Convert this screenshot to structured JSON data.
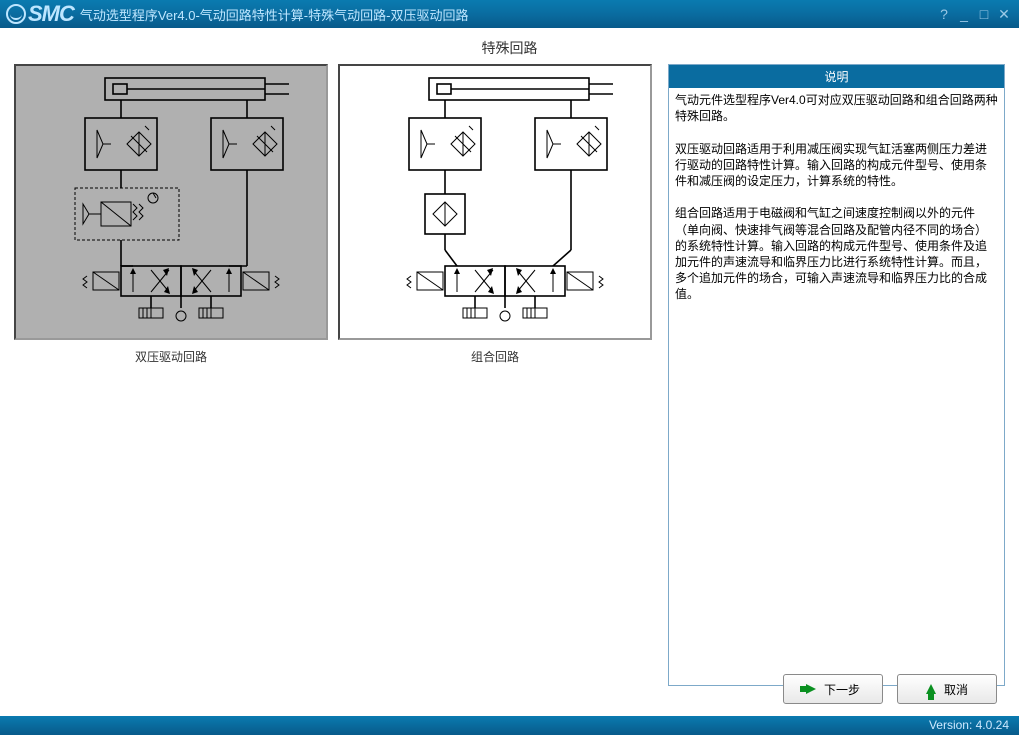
{
  "titlebar": {
    "logo_text": "SMC",
    "title": "气动选型程序Ver4.0-气动回路特性计算-特殊气动回路-双压驱动回路"
  },
  "section_title": "特殊回路",
  "options": {
    "left_label": "双压驱动回路",
    "right_label": "组合回路"
  },
  "info": {
    "header": "说明",
    "body": "气动元件选型程序Ver4.0可对应双压驱动回路和组合回路两种特殊回路。\n\n双压驱动回路适用于利用减压阀实现气缸活塞两侧压力差进行驱动的回路特性计算。输入回路的构成元件型号、使用条件和减压阀的设定压力，计算系统的特性。\n\n组合回路适用于电磁阀和气缸之间速度控制阀以外的元件（单向阀、快速排气阀等混合回路及配管内径不同的场合）的系统特性计算。输入回路的构成元件型号、使用条件及追加元件的声速流导和临界压力比进行系统特性计算。而且，多个追加元件的场合，可输入声速流导和临界压力比的合成值。"
  },
  "buttons": {
    "next": "下一步",
    "cancel": "取消"
  },
  "footer": {
    "version": "Version: 4.0.24"
  }
}
